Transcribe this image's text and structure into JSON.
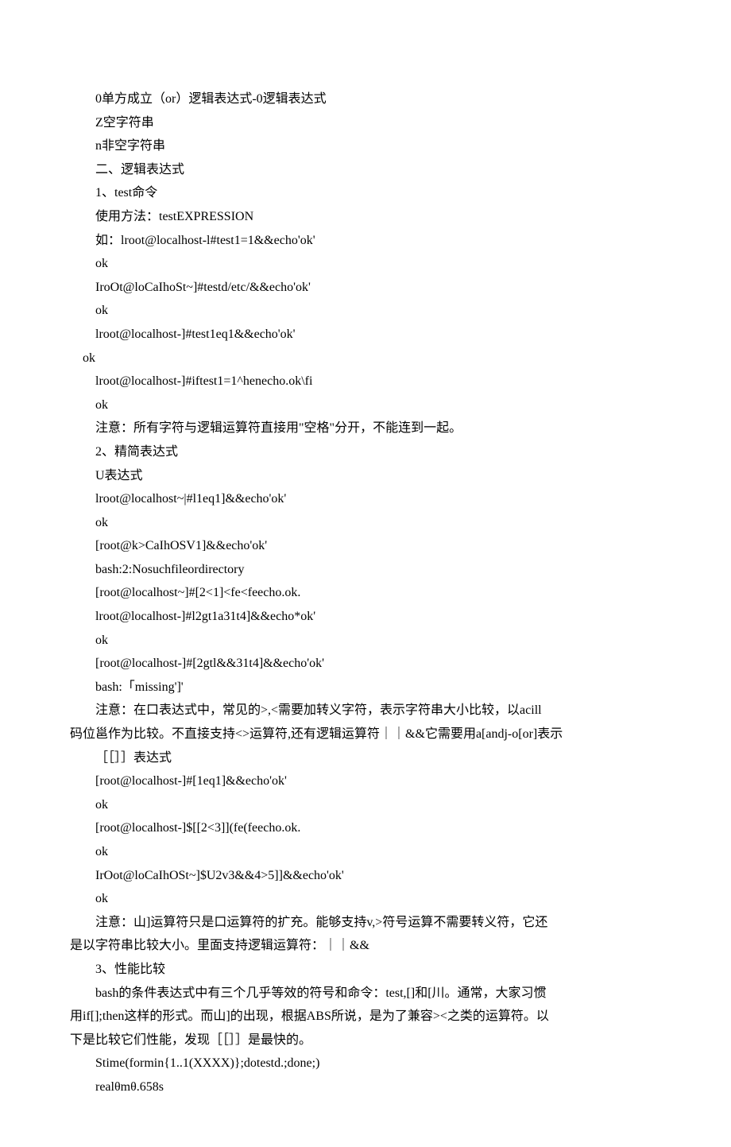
{
  "lines": {
    "l01": "0单方成立（or）逻辑表达式-0逻辑表达式",
    "l02": "Z空字符串",
    "l03": "n非空字符串",
    "l04": "二、逻辑表达式",
    "l05": "1、test命令",
    "l06": "使用方法：testEXPRESSION",
    "l07": "如：lroot@localhost-l#test1=1&&echo'ok'",
    "l08": "ok",
    "l09": "IroOt@loCaIhoSt~]#testd/etc/&&echo'ok'",
    "l10": "ok",
    "l11": "lroot@localhost-]#test1eq1&&echo'ok'",
    "l12": "ok",
    "l13": "lroot@localhost-]#iftest1=1^henecho.ok\\fi",
    "l14": "ok",
    "l15": "注意：所有字符与逻辑运算符直接用\"空格\"分开，不能连到一起。",
    "l16": "2、精简表达式",
    "l17": "U表达式",
    "l18": "lroot@localhost~|#l1eq1]&&echo'ok'",
    "l19": "ok",
    "l20": "[root@k>CaIhOSV1]&&echo'ok'",
    "l21": "bash:2:Nosuchfileordirectory",
    "l22": "[root@localhost~]#[2<1]<fe<feecho.ok.",
    "l23": "lroot@localhost-]#l2gt1a31t4]&&echo*ok'",
    "l24": "ok",
    "l25": "[root@localhost-]#[2gtl&&31t4]&&echo'ok'",
    "l26": "bash:「missing']'",
    "p1a": "注意：在口表达式中，常见的>,<需要加转义字符，表示字符串大小比较，以acill",
    "p1b": "码位邕作为比较。不直接支持<>运算符,还有逻辑运算符｜｜&&它需要用a[andj-o[or]表示",
    "l27": "［［］］表达式",
    "l28": "[root@localhost-]#[1eq1]&&echo'ok'",
    "l29": "ok",
    "l30": "[root@localhost-]$[[2<3]](fe(feecho.ok.",
    "l31": "ok",
    "l32": "IrOot@loCaIhOSt~]$U2v3&&4>5]]&&echo'ok'",
    "l33": "ok",
    "p2a": "注意：山]运算符只是口运算符的扩充。能够支持v,>符号运算不需要转义符，它还",
    "p2b": "是以字符串比较大小。里面支持逻辑运算符：｜｜&&",
    "l34": "3、性能比较",
    "p3a": "bash的条件表达式中有三个几乎等效的符号和命令：test,[]和[川。通常，大家习惯",
    "p3b": "用if[];then这样的形式。而山]的出现，根据ABS所说，是为了兼容><之类的运算符。以",
    "p3c": "下是比较它们性能，发现［［］］是最快的。",
    "l35": "Stime(formin{1..1(XXXX)};dotestd.;done;)",
    "l36": "realθmθ.658s"
  }
}
